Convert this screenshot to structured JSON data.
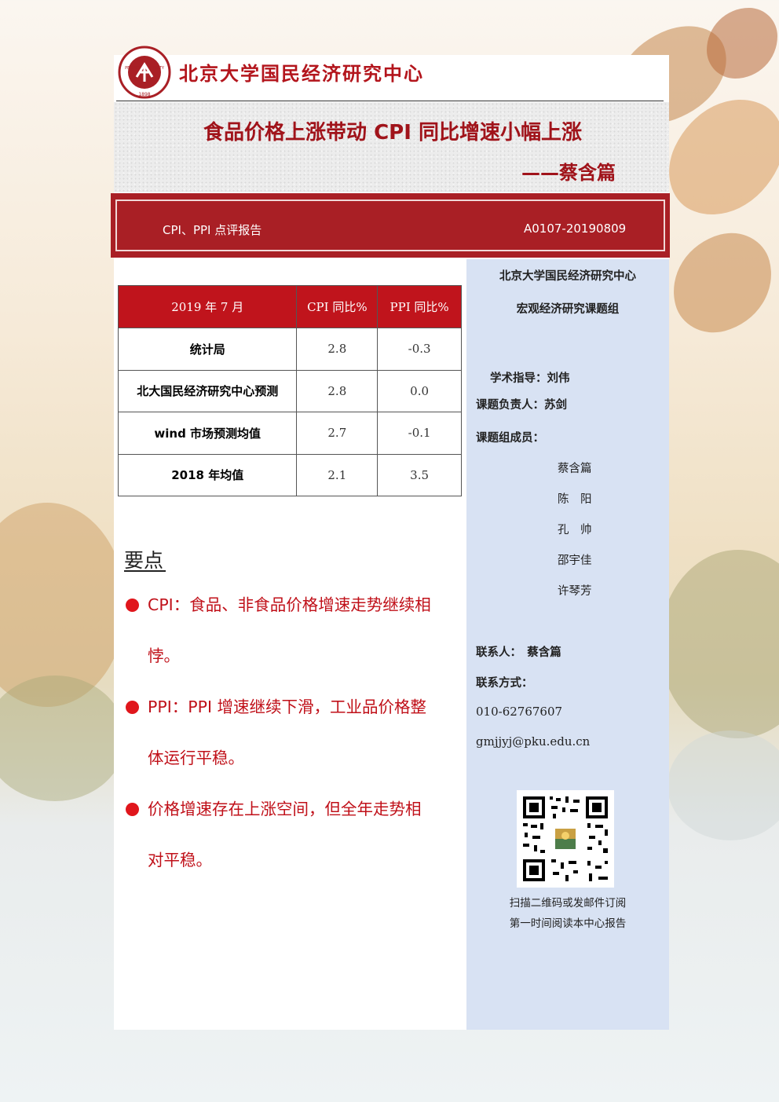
{
  "header": {
    "org_name": "北京大学国民经济研究中心",
    "logo_text_top": "PEKING UNIVERSITY",
    "logo_year": "1898"
  },
  "title": {
    "main": "食品价格上涨带动 CPI 同比增速小幅上涨",
    "author": "——蔡含篇"
  },
  "banner": {
    "left": "CPI、PPI 点评报告",
    "right": "A0107-20190809"
  },
  "table": {
    "headers": [
      "2019 年 7 月",
      "CPI 同比%",
      "PPI 同比%"
    ],
    "rows": [
      {
        "label": "统计局",
        "cpi": "2.8",
        "ppi": "-0.3"
      },
      {
        "label": "北大国民经济研究中心预测",
        "cpi": "2.8",
        "ppi": "0.0"
      },
      {
        "label": "wind 市场预测均值",
        "cpi": "2.7",
        "ppi": "-0.1"
      },
      {
        "label": "2018 年均值",
        "cpi": "2.1",
        "ppi": "3.5"
      }
    ]
  },
  "key_points": {
    "title": "要点",
    "items": [
      {
        "line1": "CPI：食品、非食品价格增速走势继续相",
        "line2": "悖。"
      },
      {
        "line1": "PPI：PPI 增速继续下滑，工业品价格整",
        "line2": "体运行平稳。"
      },
      {
        "line1": "价格增速存在上涨空间，但全年走势相",
        "line2": "对平稳。"
      }
    ]
  },
  "sidebar": {
    "center_name": "北京大学国民经济研究中心",
    "group_name": "宏观经济研究课题组",
    "advisor": "学术指导：刘伟",
    "leader": "课题负责人：苏剑",
    "members_label": "课题组成员：",
    "members": [
      "蔡含篇",
      "陈　阳",
      "孔　帅",
      "邵宇佳",
      "许琴芳"
    ],
    "contact_label": "联系人：　蔡含篇",
    "contact_method_label": "联系方式：",
    "phone": "010-62767607",
    "email": "gmjjyj@pku.edu.cn",
    "qr_caption_1": "扫描二维码或发邮件订阅",
    "qr_caption_2": "第一时间阅读本中心报告"
  },
  "colors": {
    "brand_red": "#a91f25",
    "header_red": "#c0141c",
    "sidebar_blue": "#d8e2f3"
  }
}
